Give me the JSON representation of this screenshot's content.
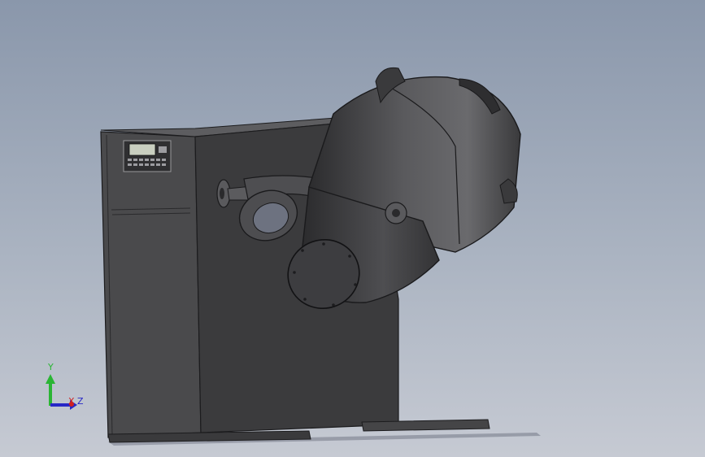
{
  "scene": {
    "background_top": "#8a97ab",
    "background_bottom": "#c6cad3",
    "model_color": "#3a3a3c"
  },
  "triad": {
    "y_label": "Y",
    "x_label": "X",
    "z_label": "Z",
    "y_color": "#2ab534",
    "x_color": "#d02020",
    "z_color": "#2727c6"
  },
  "control_panel": {
    "display_icon": "lcd-display-icon",
    "keypad_icon": "keypad-icon"
  }
}
